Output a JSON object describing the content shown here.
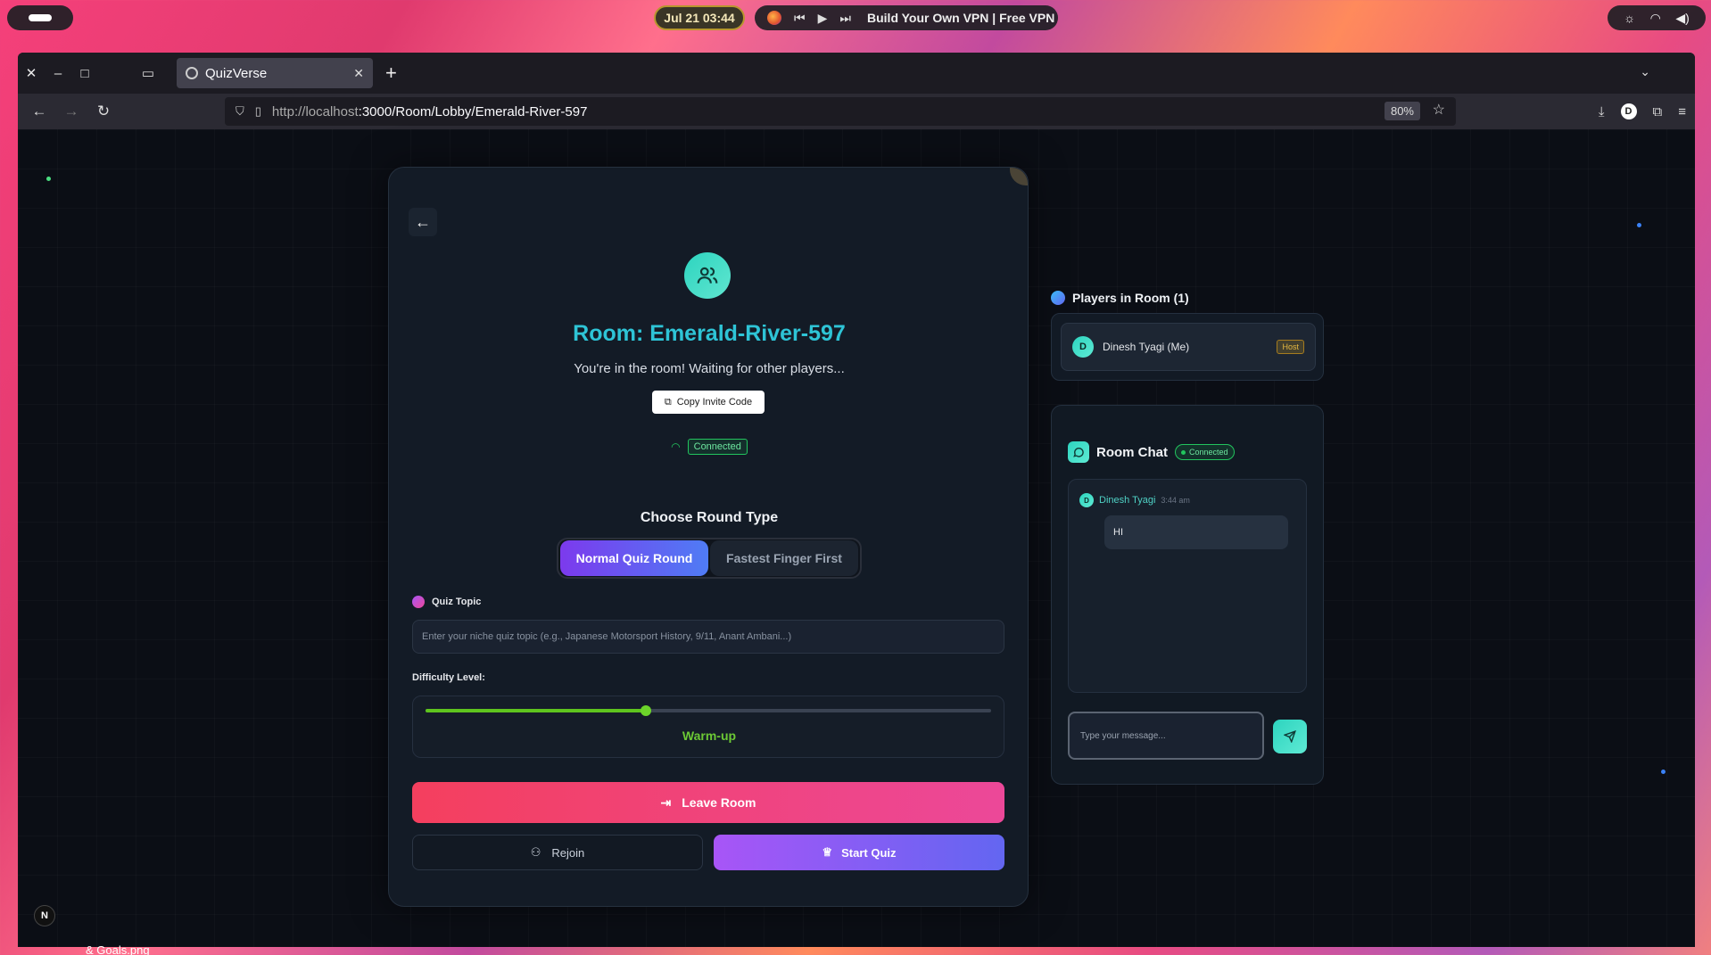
{
  "topbar": {
    "clock": "Jul 21  03:44",
    "media_title": "Build Your Own VPN | Free VPN"
  },
  "browser": {
    "tab_title": "QuizVerse",
    "url_host": "http://localhost",
    "url_path": ":3000/Room/Lobby/Emerald-River-597",
    "zoom": "80%",
    "profile_initial": "D"
  },
  "room": {
    "title": "Room: Emerald-River-597",
    "waiting_text": "You're in the room! Waiting for other players...",
    "copy_invite": "Copy Invite Code",
    "status": "Connected"
  },
  "round": {
    "label": "Choose Round Type",
    "options": [
      "Normal Quiz Round",
      "Fastest Finger First"
    ],
    "selected": "Normal Quiz Round"
  },
  "quiz_topic": {
    "label": "Quiz Topic",
    "placeholder": "Enter your niche quiz topic (e.g., Japanese Motorsport History, 9/11, Anant Ambani...)",
    "value": ""
  },
  "difficulty": {
    "label": "Difficulty Level:",
    "value_label": "Warm-up",
    "level_fraction": 0.39
  },
  "actions": {
    "leave": "Leave Room",
    "rejoin": "Rejoin",
    "start": "Start Quiz"
  },
  "players": {
    "heading": "Players in Room (1)",
    "list": [
      {
        "initial": "D",
        "name": "Dinesh Tyagi (Me)",
        "badge": "Host"
      }
    ]
  },
  "chat": {
    "title": "Room Chat",
    "status": "Connected",
    "messages": [
      {
        "initial": "D",
        "author": "Dinesh Tyagi",
        "time": "3:44 am",
        "text": "HI"
      }
    ],
    "input_placeholder": "Type your message..."
  },
  "dev": {
    "next_badge": "N"
  },
  "desktop": {
    "file_label": "& Goals.png"
  },
  "colors": {
    "accent_teal": "#2ec4d6",
    "leave_gradient": [
      "#f43f5e",
      "#ec4899"
    ],
    "start_gradient": [
      "#a855f7",
      "#6366f1"
    ],
    "difficulty_green": "#5ec41e"
  }
}
